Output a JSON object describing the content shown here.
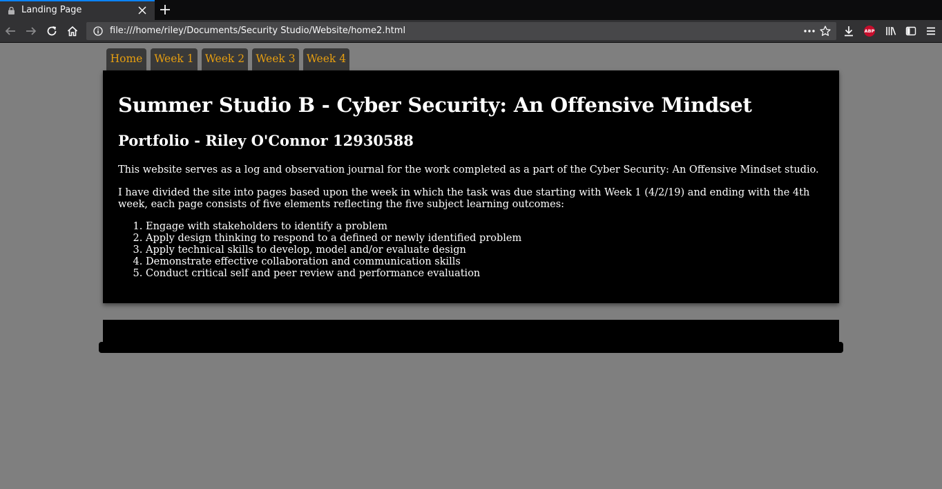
{
  "browser": {
    "tab_title": "Landing Page",
    "url": "file:///home/riley/Documents/Security Studio/Website/home2.html",
    "adblock_label": "ABP"
  },
  "site_nav": {
    "items": [
      "Home",
      "Week 1",
      "Week 2",
      "Week 3",
      "Week 4"
    ]
  },
  "main": {
    "title": "Summer Studio B - Cyber Security: An Offensive Mindset",
    "subtitle": "Portfolio - Riley O'Connor 12930588",
    "intro": "This website serves as a log and observation journal for the work completed as a part of the Cyber Security: An Offensive Mindset studio.",
    "description": "I have divided the site into pages based upon the week in which the task was due starting with Week 1 (4/2/19) and ending with the 4th week, each page consists of five elements reflecting the five subject learning outcomes:",
    "outcomes": [
      "Engage with stakeholders to identify a problem",
      "Apply design thinking to respond to a defined or newly identified problem",
      "Apply technical skills to develop, model and/or evaluate design",
      "Demonstrate effective collaboration and communication skills",
      "Conduct critical self and peer review and performance evaluation"
    ]
  },
  "colors": {
    "page_bg": "#7f7f7f",
    "panel_bg": "#000000",
    "nav_tab_bg": "#393939",
    "nav_link": "#e69e10"
  }
}
